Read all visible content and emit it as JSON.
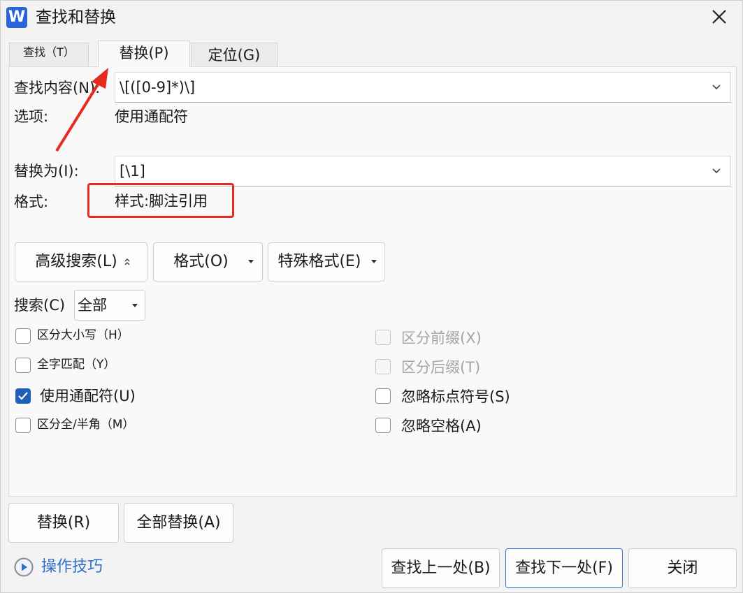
{
  "window": {
    "title": "查找和替换",
    "app_icon_letter": "W",
    "close_icon": "close-icon"
  },
  "tabs": [
    {
      "label": "查找（T）",
      "active": false
    },
    {
      "label": "替换(P)",
      "active": true
    },
    {
      "label": "定位(G)",
      "active": false
    }
  ],
  "find": {
    "label": "查找内容(N):",
    "value": "\\[([0-9]*)\\]"
  },
  "options": {
    "label": "选项:",
    "value": "使用通配符"
  },
  "replace": {
    "label": "替换为(I):",
    "value": "[\\1]"
  },
  "format": {
    "label": "格式:",
    "value": "样式:脚注引用"
  },
  "buttons": {
    "advanced": "高级搜索(L)",
    "format": "格式(O)",
    "special": "特殊格式(E)",
    "replace": "替换(R)",
    "replace_all": "全部替换(A)",
    "find_prev": "查找上一处(B)",
    "find_next": "查找下一处(F)",
    "close": "关闭"
  },
  "search": {
    "label": "搜索(C)",
    "value": "全部"
  },
  "checkboxes_left": [
    {
      "label": "区分大小写（H）",
      "checked": false
    },
    {
      "label": "全字匹配（Y）",
      "checked": false
    },
    {
      "label": "使用通配符(U)",
      "checked": true
    },
    {
      "label": "区分全/半角（M）",
      "checked": false
    }
  ],
  "checkboxes_right": [
    {
      "label": "区分前缀(X)",
      "checked": false,
      "disabled": true
    },
    {
      "label": "区分后缀(T)",
      "checked": false,
      "disabled": true
    },
    {
      "label": "忽略标点符号(S)",
      "checked": false,
      "disabled": false
    },
    {
      "label": "忽略空格(A)",
      "checked": false,
      "disabled": false
    }
  ],
  "tips_link": "操作技巧",
  "colors": {
    "accent": "#1f5fb8",
    "annotation": "#e52a1f",
    "link": "#2f6fc9"
  }
}
